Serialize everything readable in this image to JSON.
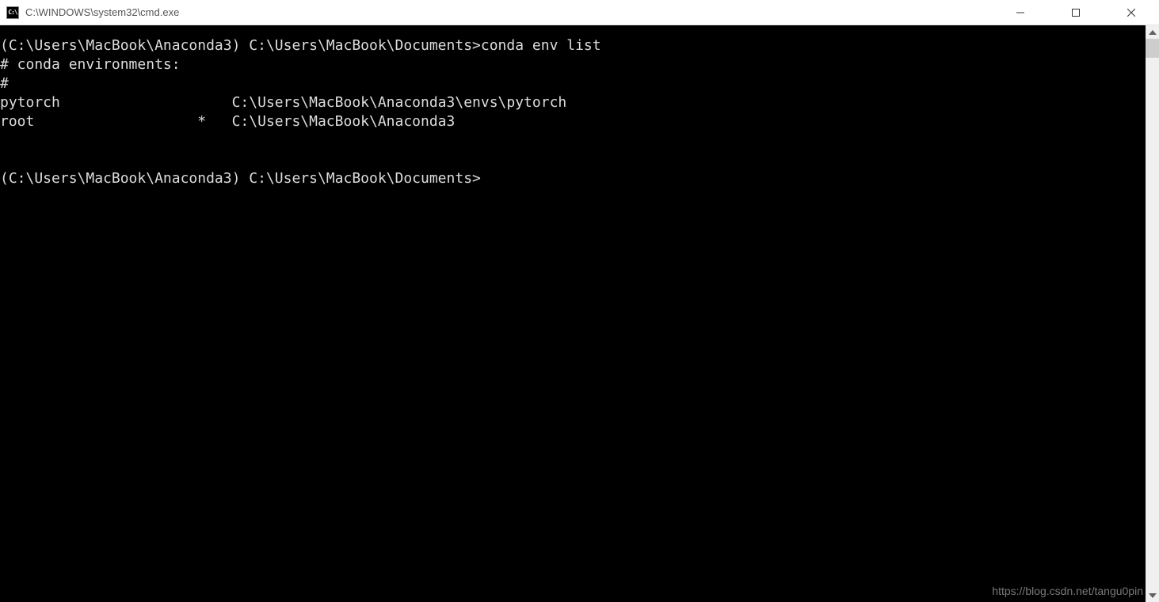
{
  "window": {
    "title": "C:\\WINDOWS\\system32\\cmd.exe",
    "icon_label": "C:\\"
  },
  "terminal": {
    "lines": [
      {
        "prompt_env": "(C:\\Users\\MacBook\\Anaconda3)",
        "prompt_path": "C:\\Users\\MacBook\\Documents>",
        "command": "conda env list"
      },
      {
        "text": "# conda environments:"
      },
      {
        "text": "#"
      },
      {
        "env_name": "pytorch",
        "active": "",
        "path": "C:\\Users\\MacBook\\Anaconda3\\envs\\pytorch"
      },
      {
        "env_name": "root",
        "active": "*",
        "path": "C:\\Users\\MacBook\\Anaconda3"
      },
      {
        "text": ""
      },
      {
        "text": ""
      },
      {
        "prompt_env": "(C:\\Users\\MacBook\\Anaconda3)",
        "prompt_path": "C:\\Users\\MacBook\\Documents>",
        "command": ""
      }
    ]
  },
  "watermark": "https://blog.csdn.net/tangu0pin"
}
